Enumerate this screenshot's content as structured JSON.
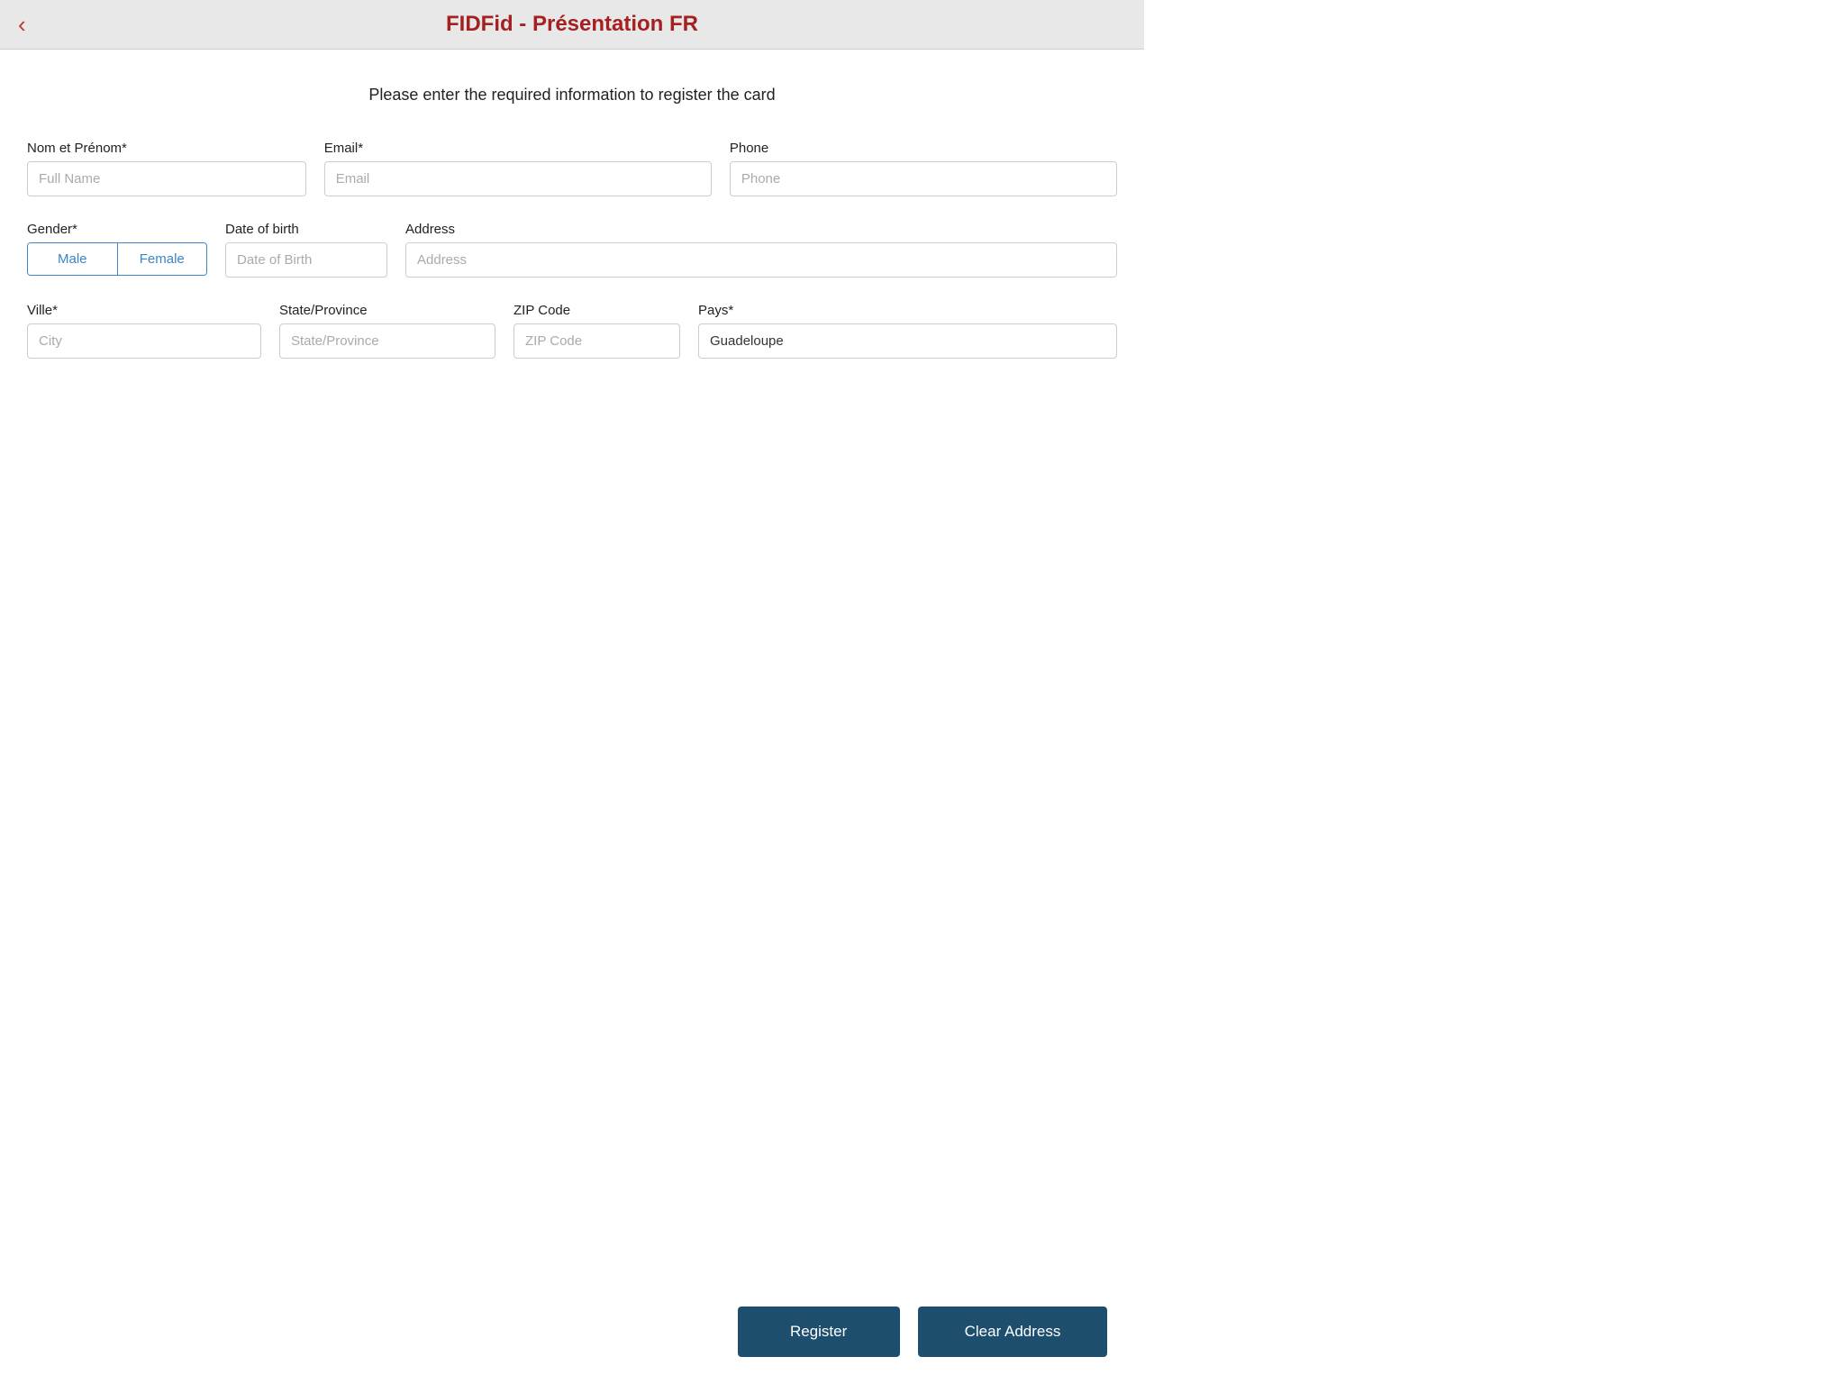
{
  "header": {
    "title": "FIDFid - Présentation FR",
    "back_label": "‹"
  },
  "form": {
    "intro": "Please enter the required information to register the card",
    "fields": {
      "fullname": {
        "label": "Nom et Prénom*",
        "placeholder": "Full Name"
      },
      "email": {
        "label": "Email*",
        "placeholder": "Email"
      },
      "phone": {
        "label": "Phone",
        "placeholder": "Phone"
      },
      "gender": {
        "label": "Gender*",
        "male_label": "Male",
        "female_label": "Female"
      },
      "dob": {
        "label": "Date of birth",
        "placeholder": "Date of Birth"
      },
      "address": {
        "label": "Address",
        "placeholder": "Address"
      },
      "city": {
        "label": "Ville*",
        "placeholder": "City"
      },
      "state": {
        "label": "State/Province",
        "placeholder": "State/Province"
      },
      "zip": {
        "label": "ZIP Code",
        "placeholder": "ZIP Code"
      },
      "pays": {
        "label": "Pays*",
        "value": "Guadeloupe"
      }
    },
    "buttons": {
      "register": "Register",
      "clear": "Clear Address"
    }
  }
}
